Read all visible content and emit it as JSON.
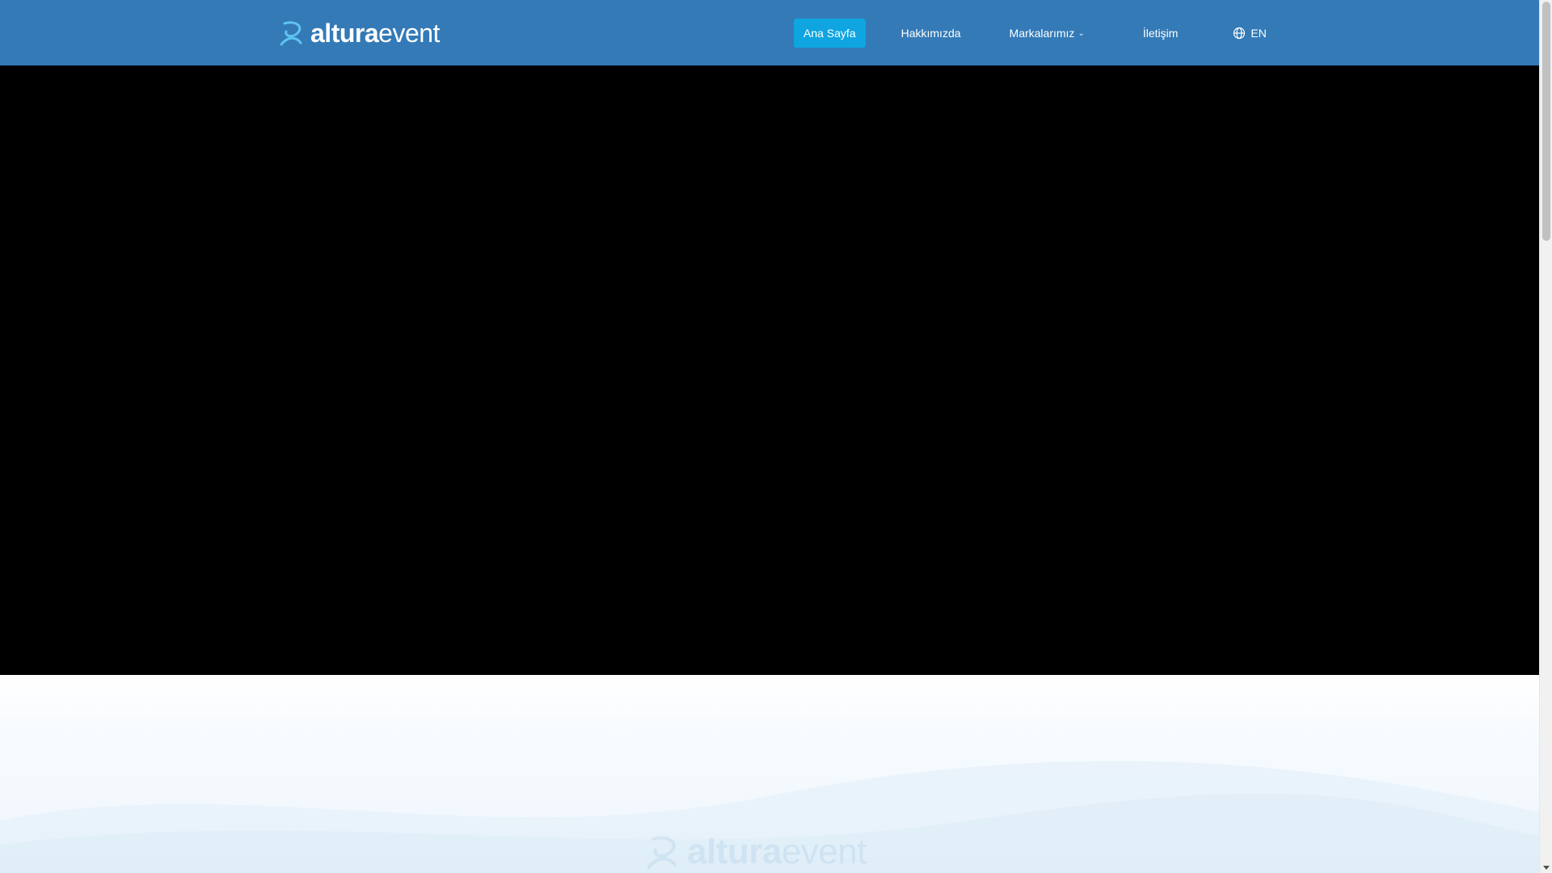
{
  "brand": {
    "name_bold": "altura",
    "name_light": "event"
  },
  "nav": {
    "items": [
      {
        "label": "Ana Sayfa",
        "active": true
      },
      {
        "label": "Hakkımızda",
        "active": false
      },
      {
        "label": "Markalarımız",
        "active": false,
        "dropdown": true
      },
      {
        "label": "İletişim",
        "active": false
      }
    ],
    "language": "EN"
  },
  "icons": {
    "logo": "altura-logo-icon",
    "globe": "globe-icon",
    "chevron": "chevron-down-icon"
  },
  "colors": {
    "header_bg": "#337ab7",
    "active_nav_bg": "#0ea5e0",
    "hero_bg": "#000000"
  }
}
